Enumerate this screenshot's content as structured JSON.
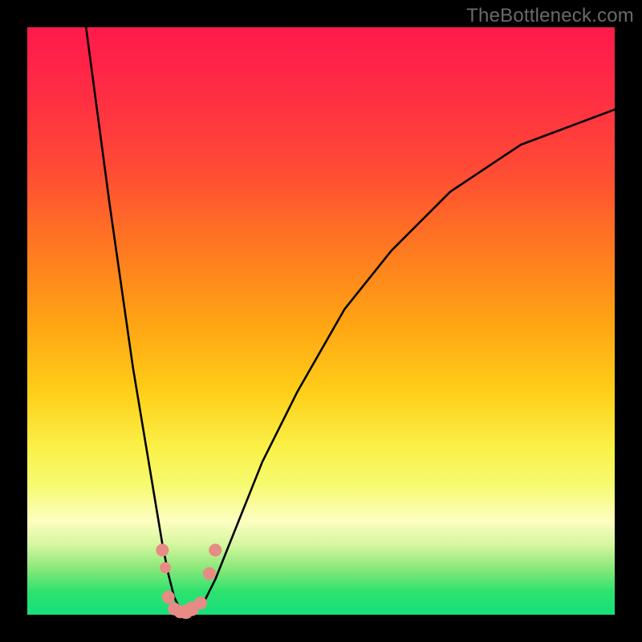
{
  "watermark": "TheBottleneck.com",
  "chart_data": {
    "type": "line",
    "title": "",
    "xlabel": "",
    "ylabel": "",
    "xlim": [
      0,
      100
    ],
    "ylim": [
      0,
      100
    ],
    "grid": false,
    "legend": false,
    "series": [
      {
        "name": "bottleneck-curve",
        "color": "#000000",
        "x": [
          10,
          12,
          14,
          16,
          18,
          20,
          22,
          23,
          24,
          25,
          26,
          27,
          28,
          30,
          32,
          36,
          40,
          46,
          54,
          62,
          72,
          84,
          100
        ],
        "y": [
          100,
          85,
          70,
          56,
          42,
          30,
          18,
          12,
          7,
          3,
          1,
          0,
          0.5,
          2,
          6,
          16,
          26,
          38,
          52,
          62,
          72,
          80,
          86
        ]
      }
    ],
    "markers": [
      {
        "name": "marker",
        "x": 23.0,
        "y": 11,
        "color": "#e88b85",
        "r": 8
      },
      {
        "name": "marker",
        "x": 23.5,
        "y": 8,
        "color": "#e88b85",
        "r": 7
      },
      {
        "name": "marker",
        "x": 24.0,
        "y": 3,
        "color": "#e88b85",
        "r": 8
      },
      {
        "name": "marker",
        "x": 25.0,
        "y": 1,
        "color": "#e88b85",
        "r": 8
      },
      {
        "name": "marker",
        "x": 26.0,
        "y": 0.5,
        "color": "#e88b85",
        "r": 8
      },
      {
        "name": "marker",
        "x": 27.0,
        "y": 0.5,
        "color": "#e88b85",
        "r": 9
      },
      {
        "name": "marker",
        "x": 28.0,
        "y": 1,
        "color": "#e88b85",
        "r": 9
      },
      {
        "name": "marker",
        "x": 29.5,
        "y": 2,
        "color": "#e88b85",
        "r": 8
      },
      {
        "name": "marker",
        "x": 31.0,
        "y": 7,
        "color": "#e88b85",
        "r": 8
      },
      {
        "name": "marker",
        "x": 32.0,
        "y": 11,
        "color": "#e88b85",
        "r": 8
      }
    ]
  }
}
